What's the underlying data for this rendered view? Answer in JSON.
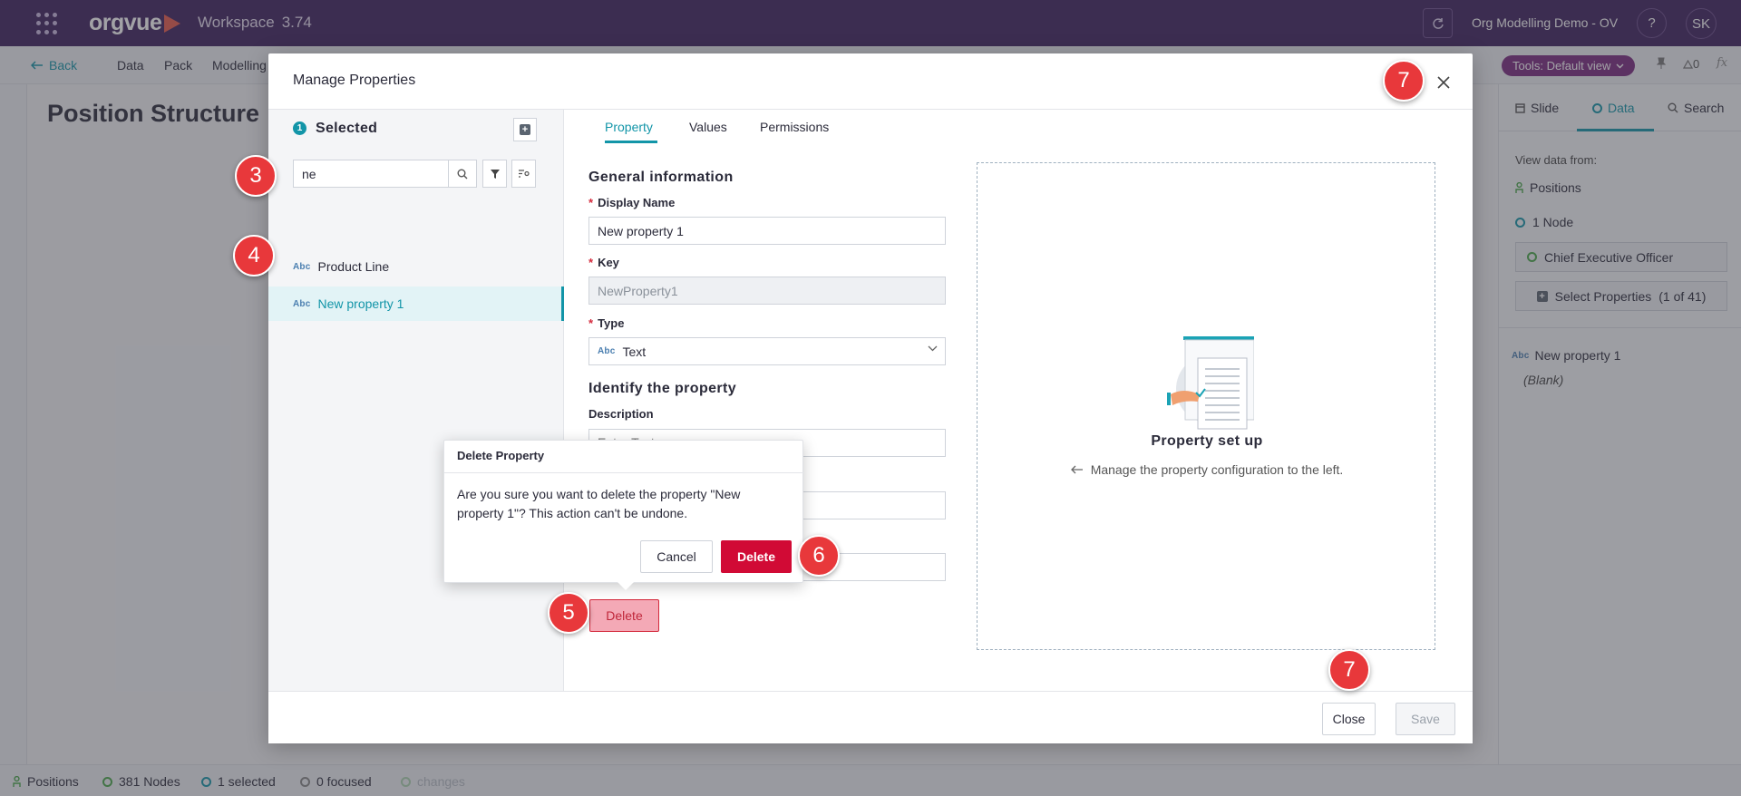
{
  "topbar": {
    "logo": "orgvue",
    "workspace": "Workspace",
    "version": "3.74",
    "org_name": "Org Modelling Demo - OV",
    "help": "?",
    "avatar": "SK"
  },
  "subbar": {
    "back": "Back",
    "menu": [
      "Data",
      "Pack",
      "Modelling"
    ],
    "tools": "Tools: Default view",
    "warning_count": "0",
    "fx": "fx"
  },
  "canvas": {
    "page_title": "Position Structure"
  },
  "right_panel": {
    "tabs": [
      "Slide",
      "Data",
      "Search"
    ],
    "view_data_from": "View data from:",
    "positions": "Positions",
    "node_count": "1 Node",
    "node_name": "Chief Executive Officer",
    "select_properties": "Select Properties",
    "select_properties_count": "(1 of 41)",
    "property_name": "New property 1",
    "property_value": "(Blank)"
  },
  "statusbar": {
    "positions": "Positions",
    "nodes": "381 Nodes",
    "selected": "1 selected",
    "focused": "0 focused",
    "changes": "changes"
  },
  "modal": {
    "title": "Manage Properties",
    "selected_count": "1",
    "selected_title": "Selected",
    "search_value": "ne",
    "properties": [
      {
        "type": "Abc",
        "name": "Product Line"
      },
      {
        "type": "Abc",
        "name": "New property 1"
      }
    ],
    "tabs": [
      "Property",
      "Values",
      "Permissions"
    ],
    "general_info": "General information",
    "display_name_label": "Display Name",
    "display_name_value": "New property 1",
    "key_label": "Key",
    "key_value": "NewProperty1",
    "type_label": "Type",
    "type_abc": "Abc",
    "type_value": "Text",
    "identify_title": "Identify the property",
    "description_label": "Description",
    "description_placeholder": "Enter Text...",
    "delete_button": "Delete",
    "setup_title": "Property set up",
    "setup_subtitle": "Manage the property configuration to the left.",
    "close_button": "Close",
    "save_button": "Save"
  },
  "popover": {
    "title": "Delete Property",
    "message": "Are you sure you want to delete the property \"New property 1\"? This action can't be undone.",
    "cancel": "Cancel",
    "delete": "Delete"
  },
  "markers": {
    "m3": "3",
    "m4": "4",
    "m5": "5",
    "m6": "6",
    "m7a": "7",
    "m7b": "7"
  },
  "colors": {
    "topbar": "#3d1f5c",
    "accent": "#1295a8",
    "danger": "#d10a35",
    "marker": "#e8383b",
    "tools_pill": "#7a2a7f"
  }
}
